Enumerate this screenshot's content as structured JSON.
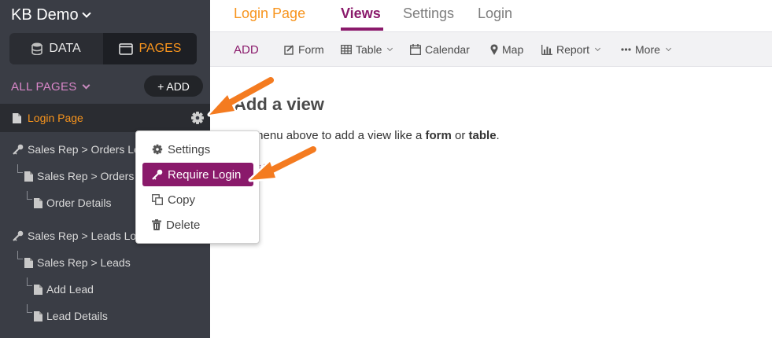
{
  "sidebar": {
    "app_title": "KB Demo",
    "toggle": {
      "data_label": "DATA",
      "pages_label": "PAGES"
    },
    "all_pages_label": "ALL PAGES",
    "add_button": "+ ADD",
    "active_page": "Login Page",
    "tree": [
      {
        "label": "Sales Rep > Orders Login",
        "icon": "key-icon"
      },
      {
        "label": "Sales Rep > Orders",
        "icon": "doc-icon"
      },
      {
        "label": "Order Details",
        "icon": "doc-icon"
      },
      {
        "label": "Sales Rep > Leads Login",
        "icon": "key-icon"
      },
      {
        "label": "Sales Rep > Leads",
        "icon": "doc-icon"
      },
      {
        "label": "Add Lead",
        "icon": "doc-icon"
      },
      {
        "label": "Lead Details",
        "icon": "doc-icon"
      }
    ]
  },
  "menu": {
    "items": [
      {
        "label": "Settings",
        "icon": "gear-icon"
      },
      {
        "label": "Require Login",
        "icon": "key-icon"
      },
      {
        "label": "Copy",
        "icon": "copy-icon"
      },
      {
        "label": "Delete",
        "icon": "trash-icon"
      }
    ]
  },
  "header": {
    "page_title": "Login Page",
    "tabs": [
      "Views",
      "Settings",
      "Login"
    ]
  },
  "toolbar": {
    "add": "ADD",
    "items": [
      "Form",
      "Table",
      "Calendar",
      "Map",
      "Report",
      "More"
    ]
  },
  "content": {
    "title": "Add a view",
    "text_pre": "the menu above to add a view like a ",
    "text_bold1": "form",
    "text_mid": " or ",
    "text_bold2": "table",
    "text_post": ".",
    "link": "views"
  },
  "colors": {
    "accent": "#8a1a6b",
    "orange": "#f7941d",
    "sidebar_bg": "#3a3d45"
  }
}
